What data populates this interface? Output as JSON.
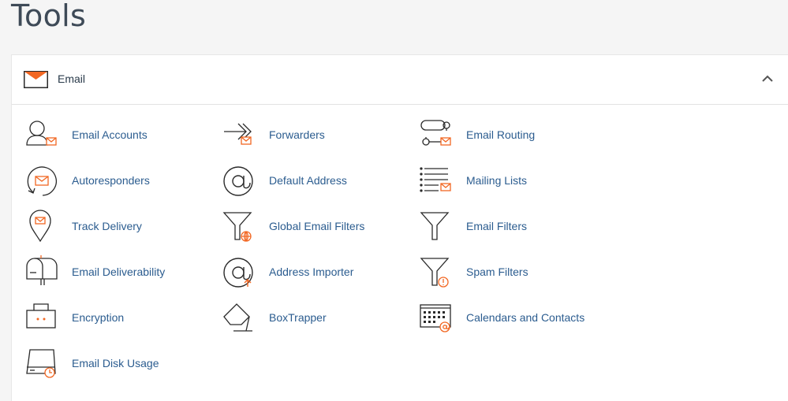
{
  "page": {
    "title": "Tools"
  },
  "panel": {
    "title": "Email",
    "header_icon": "envelope-icon",
    "collapse_icon": "chevron-up-icon"
  },
  "colors": {
    "accent": "#f26722",
    "link": "#2b5c8f",
    "icon": "#2a2a2a"
  },
  "tools": [
    {
      "label": "Email Accounts",
      "icon": "email-accounts-icon"
    },
    {
      "label": "Forwarders",
      "icon": "forwarders-icon"
    },
    {
      "label": "Email Routing",
      "icon": "email-routing-icon"
    },
    {
      "label": "Autoresponders",
      "icon": "autoresponders-icon"
    },
    {
      "label": "Default Address",
      "icon": "default-address-icon"
    },
    {
      "label": "Mailing Lists",
      "icon": "mailing-lists-icon"
    },
    {
      "label": "Track Delivery",
      "icon": "track-delivery-icon"
    },
    {
      "label": "Global Email Filters",
      "icon": "global-email-filters-icon"
    },
    {
      "label": "Email Filters",
      "icon": "email-filters-icon"
    },
    {
      "label": "Email Deliverability",
      "icon": "email-deliverability-icon"
    },
    {
      "label": "Address Importer",
      "icon": "address-importer-icon"
    },
    {
      "label": "Spam Filters",
      "icon": "spam-filters-icon"
    },
    {
      "label": "Encryption",
      "icon": "encryption-icon"
    },
    {
      "label": "BoxTrapper",
      "icon": "boxtrapper-icon"
    },
    {
      "label": "Calendars and Contacts",
      "icon": "calendars-contacts-icon"
    },
    {
      "label": "Email Disk Usage",
      "icon": "email-disk-usage-icon"
    }
  ]
}
